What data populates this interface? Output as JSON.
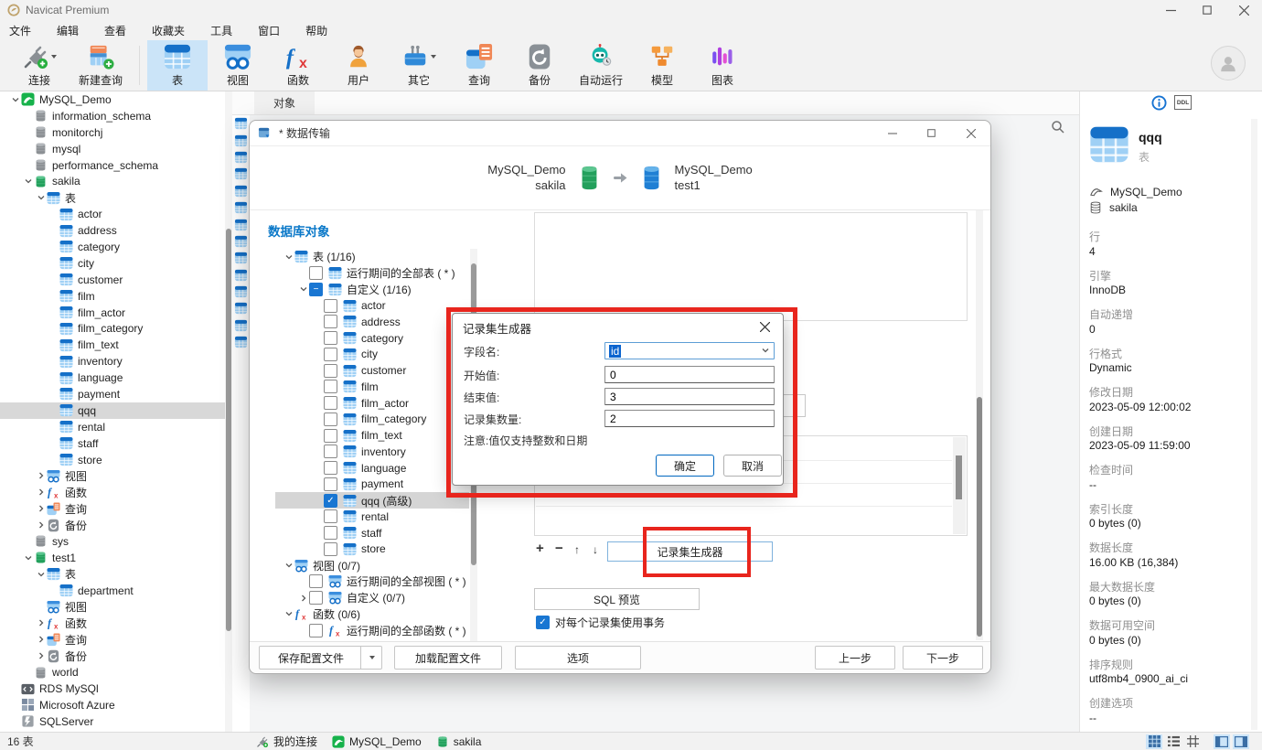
{
  "window": {
    "title": "Navicat Premium"
  },
  "menubar": {
    "items": [
      "文件",
      "编辑",
      "查看",
      "收藏夹",
      "工具",
      "窗口",
      "帮助"
    ]
  },
  "toolbar": {
    "items": [
      {
        "label": "连接",
        "icon": "connection-icon",
        "dropdown": true
      },
      {
        "label": "新建查询",
        "icon": "new-query-icon"
      },
      {
        "label": "表",
        "icon": "table-icon",
        "selected": true
      },
      {
        "label": "视图",
        "icon": "view-icon"
      },
      {
        "label": "函数",
        "icon": "function-icon"
      },
      {
        "label": "用户",
        "icon": "user-icon"
      },
      {
        "label": "其它",
        "icon": "others-icon",
        "dropdown": true
      },
      {
        "label": "查询",
        "icon": "query-icon"
      },
      {
        "label": "备份",
        "icon": "backup-icon"
      },
      {
        "label": "自动运行",
        "icon": "automation-icon"
      },
      {
        "label": "模型",
        "icon": "model-icon"
      },
      {
        "label": "图表",
        "icon": "chart-icon"
      }
    ]
  },
  "sidebar": {
    "tree": [
      {
        "label": "MySQL_Demo",
        "icon": "mysql-connection-icon",
        "level": 0,
        "arrow": "down"
      },
      {
        "label": "information_schema",
        "icon": "database-gray-icon",
        "level": 1
      },
      {
        "label": "monitorchj",
        "icon": "database-gray-icon",
        "level": 1
      },
      {
        "label": "mysql",
        "icon": "database-gray-icon",
        "level": 1
      },
      {
        "label": "performance_schema",
        "icon": "database-gray-icon",
        "level": 1
      },
      {
        "label": "sakila",
        "icon": "database-open-icon",
        "level": 1,
        "arrow": "down"
      },
      {
        "label": "表",
        "icon": "table-icon",
        "level": 2,
        "arrow": "down"
      },
      {
        "label": "actor",
        "icon": "table-icon",
        "level": 3
      },
      {
        "label": "address",
        "icon": "table-icon",
        "level": 3
      },
      {
        "label": "category",
        "icon": "table-icon",
        "level": 3
      },
      {
        "label": "city",
        "icon": "table-icon",
        "level": 3
      },
      {
        "label": "customer",
        "icon": "table-icon",
        "level": 3
      },
      {
        "label": "film",
        "icon": "table-icon",
        "level": 3
      },
      {
        "label": "film_actor",
        "icon": "table-icon",
        "level": 3
      },
      {
        "label": "film_category",
        "icon": "table-icon",
        "level": 3
      },
      {
        "label": "film_text",
        "icon": "table-icon",
        "level": 3
      },
      {
        "label": "inventory",
        "icon": "table-icon",
        "level": 3
      },
      {
        "label": "language",
        "icon": "table-icon",
        "level": 3
      },
      {
        "label": "payment",
        "icon": "table-icon",
        "level": 3
      },
      {
        "label": "qqq",
        "icon": "table-icon",
        "level": 3,
        "selected": true
      },
      {
        "label": "rental",
        "icon": "table-icon",
        "level": 3
      },
      {
        "label": "staff",
        "icon": "table-icon",
        "level": 3
      },
      {
        "label": "store",
        "icon": "table-icon",
        "level": 3
      },
      {
        "label": "视图",
        "icon": "view-icon",
        "level": 2,
        "arrow": "right"
      },
      {
        "label": "函数",
        "icon": "function-icon",
        "level": 2,
        "arrow": "right"
      },
      {
        "label": "查询",
        "icon": "query-icon",
        "level": 2,
        "arrow": "right"
      },
      {
        "label": "备份",
        "icon": "backup-icon",
        "level": 2,
        "arrow": "right"
      },
      {
        "label": "sys",
        "icon": "database-gray-icon",
        "level": 1
      },
      {
        "label": "test1",
        "icon": "database-open-icon",
        "level": 1,
        "arrow": "down"
      },
      {
        "label": "表",
        "icon": "table-icon",
        "level": 2,
        "arrow": "down"
      },
      {
        "label": "department",
        "icon": "table-icon",
        "level": 3
      },
      {
        "label": "视图",
        "icon": "view-icon",
        "level": 2
      },
      {
        "label": "函数",
        "icon": "function-icon",
        "level": 2,
        "arrow": "right"
      },
      {
        "label": "查询",
        "icon": "query-icon",
        "level": 2,
        "arrow": "right"
      },
      {
        "label": "备份",
        "icon": "backup-icon",
        "level": 2,
        "arrow": "right"
      },
      {
        "label": "world",
        "icon": "database-gray-icon",
        "level": 1
      },
      {
        "label": "RDS MySQl",
        "icon": "rds-connection-icon",
        "level": 0
      },
      {
        "label": "Microsoft Azure",
        "icon": "azure-connection-icon",
        "level": 0
      },
      {
        "label": "SQLServer",
        "icon": "sqlserver-connection-icon",
        "level": 0
      }
    ]
  },
  "main": {
    "tab": "对象",
    "hidden_object_rows": 14
  },
  "transfer_dialog": {
    "title": "* 数据传输",
    "source": {
      "connection": "MySQL_Demo",
      "database": "sakila"
    },
    "target": {
      "connection": "MySQL_Demo",
      "database": "test1"
    },
    "section_title": "数据库对象",
    "tree": [
      {
        "label": "表 (1/16)",
        "icon": "table-icon",
        "level": 0,
        "arrow": "down"
      },
      {
        "label": "运行期间的全部表 ( * )",
        "icon": "table-icon",
        "level": 1,
        "check": "unchecked"
      },
      {
        "label": "自定义 (1/16)",
        "icon": "table-icon",
        "level": 1,
        "arrow": "down",
        "check": "indeterminate"
      },
      {
        "label": "actor",
        "icon": "table-icon",
        "level": 2,
        "check": "unchecked"
      },
      {
        "label": "address",
        "icon": "table-icon",
        "level": 2,
        "check": "unchecked"
      },
      {
        "label": "category",
        "icon": "table-icon",
        "level": 2,
        "check": "unchecked"
      },
      {
        "label": "city",
        "icon": "table-icon",
        "level": 2,
        "check": "unchecked"
      },
      {
        "label": "customer",
        "icon": "table-icon",
        "level": 2,
        "check": "unchecked"
      },
      {
        "label": "film",
        "icon": "table-icon",
        "level": 2,
        "check": "unchecked"
      },
      {
        "label": "film_actor",
        "icon": "table-icon",
        "level": 2,
        "check": "unchecked"
      },
      {
        "label": "film_category",
        "icon": "table-icon",
        "level": 2,
        "check": "unchecked"
      },
      {
        "label": "film_text",
        "icon": "table-icon",
        "level": 2,
        "check": "unchecked"
      },
      {
        "label": "inventory",
        "icon": "table-icon",
        "level": 2,
        "check": "unchecked"
      },
      {
        "label": "language",
        "icon": "table-icon",
        "level": 2,
        "check": "unchecked"
      },
      {
        "label": "payment",
        "icon": "table-icon",
        "level": 2,
        "check": "unchecked"
      },
      {
        "label": "qqq (高级)",
        "icon": "table-icon",
        "level": 2,
        "check": "checked",
        "selected": true
      },
      {
        "label": "rental",
        "icon": "table-icon",
        "level": 2,
        "check": "unchecked"
      },
      {
        "label": "staff",
        "icon": "table-icon",
        "level": 2,
        "check": "unchecked"
      },
      {
        "label": "store",
        "icon": "table-icon",
        "level": 2,
        "check": "unchecked"
      },
      {
        "label": "视图 (0/7)",
        "icon": "view-icon",
        "level": 0,
        "arrow": "down"
      },
      {
        "label": "运行期间的全部视图 ( * )",
        "icon": "view-icon",
        "level": 1,
        "check": "unchecked"
      },
      {
        "label": "自定义 (0/7)",
        "icon": "view-icon",
        "level": 1,
        "arrow": "right",
        "check": "unchecked"
      },
      {
        "label": "函数 (0/6)",
        "icon": "function-icon",
        "level": 0,
        "arrow": "down"
      },
      {
        "label": "运行期间的全部函数 ( * )",
        "icon": "function-icon",
        "level": 1,
        "check": "unchecked"
      }
    ],
    "generator_button": "记录集生成器",
    "sql_preview_button": "SQL 预览",
    "transaction_checkbox": {
      "label": "对每个记录集使用事务",
      "checked": true
    },
    "footer": {
      "save_profile": "保存配置文件",
      "load_profile": "加载配置文件",
      "options": "选项",
      "back": "上一步",
      "next": "下一步"
    }
  },
  "generator_modal": {
    "title": "记录集生成器",
    "fields": [
      {
        "label": "字段名:",
        "value": "id",
        "type": "combo"
      },
      {
        "label": "开始值:",
        "value": "0",
        "type": "input"
      },
      {
        "label": "结束值:",
        "value": "3",
        "type": "input"
      },
      {
        "label": "记录集数量:",
        "value": "2",
        "type": "input"
      }
    ],
    "note": "注意:值仅支持整数和日期",
    "ok_button": "确定",
    "cancel_button": "取消"
  },
  "info_panel": {
    "object_name": "qqq",
    "object_type": "表",
    "connection": "MySQL_Demo",
    "database": "sakila",
    "properties": [
      {
        "label": "行",
        "value": "4"
      },
      {
        "label": "引擎",
        "value": "InnoDB"
      },
      {
        "label": "自动递增",
        "value": "0"
      },
      {
        "label": "行格式",
        "value": "Dynamic"
      },
      {
        "label": "修改日期",
        "value": "2023-05-09 12:00:02"
      },
      {
        "label": "创建日期",
        "value": "2023-05-09 11:59:00"
      },
      {
        "label": "检查时间",
        "value": "--"
      },
      {
        "label": "索引长度",
        "value": "0 bytes (0)"
      },
      {
        "label": "数据长度",
        "value": "16.00 KB (16,384)"
      },
      {
        "label": "最大数据长度",
        "value": "0 bytes (0)"
      },
      {
        "label": "数据可用空间",
        "value": "0 bytes (0)"
      },
      {
        "label": "排序规则",
        "value": "utf8mb4_0900_ai_ci"
      },
      {
        "label": "创建选项",
        "value": "--"
      }
    ]
  },
  "statusbar": {
    "object_count": "16 表",
    "path": [
      {
        "icon": "connection-icon",
        "label": "我的连接"
      },
      {
        "icon": "mysql-connection-icon",
        "label": "MySQL_Demo"
      },
      {
        "icon": "database-open-icon",
        "label": "sakila"
      }
    ]
  },
  "colors": {
    "accent": "#1570c8",
    "toolbar_selected": "#cbe4f8",
    "annotation_red": "#e8251d",
    "checkbox_blue": "#1976d2"
  }
}
